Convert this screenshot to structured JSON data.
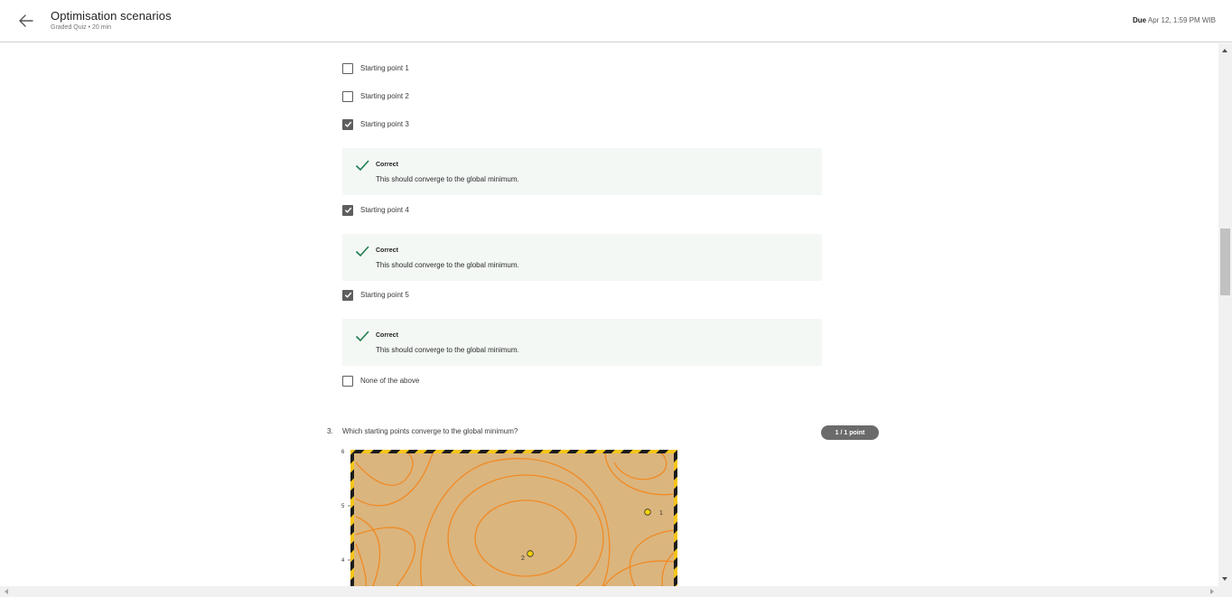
{
  "header": {
    "title": "Optimisation scenarios",
    "subtitle": "Graded Quiz • 20 min",
    "due_label": "Due",
    "due_value": "Apr 12, 1:59 PM WIB",
    "back_icon": "arrow-left-icon"
  },
  "options": [
    {
      "label": "Starting point 1",
      "checked": false
    },
    {
      "label": "Starting point 2",
      "checked": false
    },
    {
      "label": "Starting point 3",
      "checked": true
    },
    {
      "label": "Starting point 4",
      "checked": true
    },
    {
      "label": "Starting point 5",
      "checked": true
    },
    {
      "label": "None of the above",
      "checked": false
    }
  ],
  "feedback": [
    {
      "title": "Correct",
      "text": "This should converge to the global minimum."
    },
    {
      "title": "Correct",
      "text": "This should converge to the global minimum."
    },
    {
      "title": "Correct",
      "text": "This should converge to the global minimum."
    }
  ],
  "question": {
    "number": "3.",
    "text": "Which starting points converge to the global minimum?",
    "points": "1 / 1 point",
    "plot": {
      "y_ticks": [
        "6",
        "5",
        "4"
      ],
      "point_labels": [
        "1",
        "2"
      ]
    }
  },
  "colors": {
    "correct_green": "#1e7d4f",
    "feedback_bg": "#f3f8f5",
    "badge_bg": "#6b6b6b",
    "contour": "#f08a24",
    "plot_bg": "#dbb57e"
  }
}
